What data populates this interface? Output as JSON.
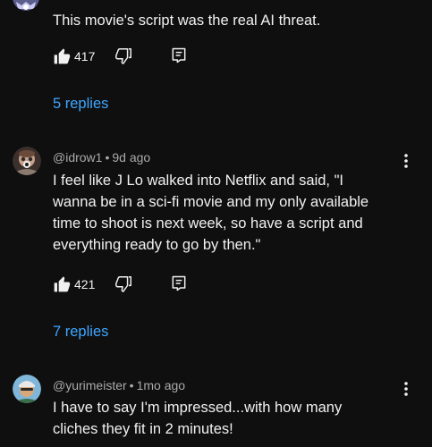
{
  "comments": [
    {
      "lines": [
        "This movie's script was the real AI threat."
      ],
      "likes": "417",
      "replies_label": "5 replies"
    },
    {
      "author": "@idrow1",
      "separator": "•",
      "time": "9d ago",
      "lines": [
        "I feel like J Lo walked into Netflix and said, \"I",
        "wanna be in a sci-fi movie and my only available",
        "time to shoot is next week, so have a script and",
        "everything ready to go by then.\""
      ],
      "likes": "421",
      "replies_label": "7 replies"
    },
    {
      "author": "@yurimeister",
      "separator": "•",
      "time": "1mo ago",
      "lines": [
        "I have to say I'm impressed...with how many",
        "cliches they fit in 2 minutes!"
      ]
    }
  ],
  "icons": {
    "like": "thumbs-up-icon",
    "dislike": "thumbs-down-icon",
    "reply": "reply-icon",
    "more": "more-vertical-icon"
  },
  "colors": {
    "background": "#0f0f0f",
    "text": "#f1f1f1",
    "meta": "#aaaaaa",
    "link": "#3ea6ff"
  }
}
